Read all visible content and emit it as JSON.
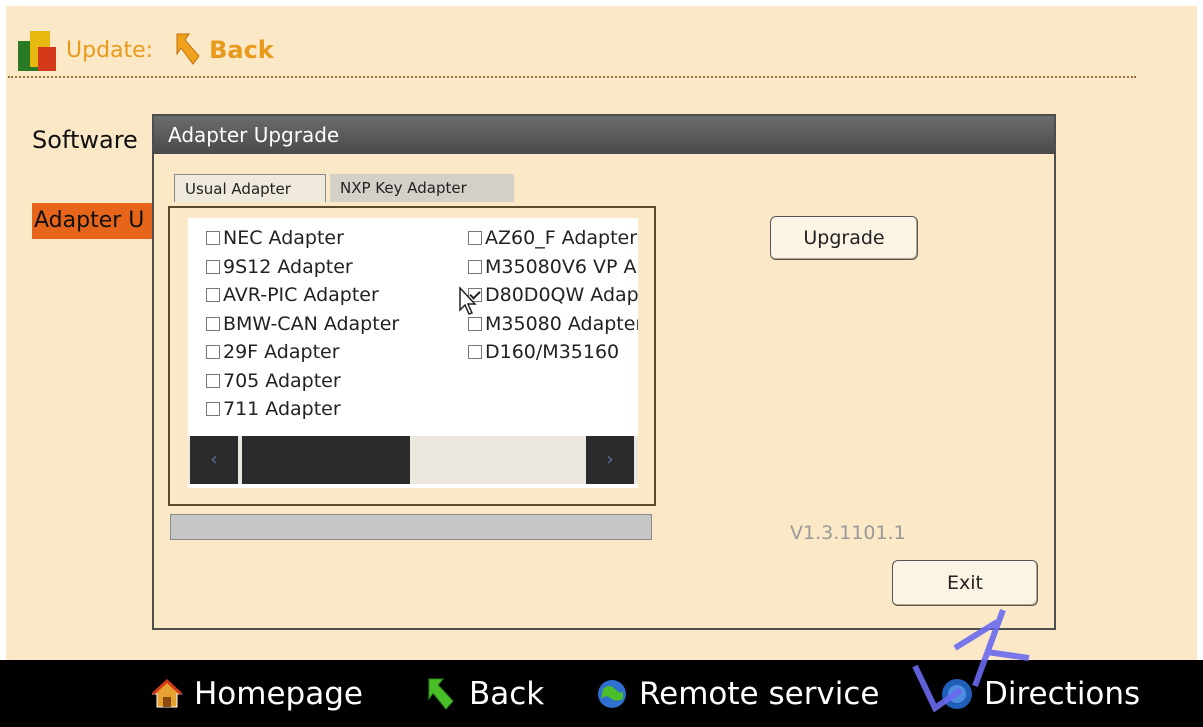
{
  "header": {
    "title": "Update:",
    "back_label": "Back"
  },
  "background": {
    "software_label": "Software",
    "adapter_label": "Adapter U"
  },
  "dialog": {
    "title": "Adapter Upgrade",
    "tabs": [
      {
        "label": "Usual Adapter",
        "active": true
      },
      {
        "label": "NXP Key Adapter",
        "active": false
      }
    ],
    "adapters_col1": [
      {
        "label": "NEC Adapter",
        "checked": false
      },
      {
        "label": "9S12 Adapter",
        "checked": false
      },
      {
        "label": "AVR-PIC Adapter",
        "checked": false
      },
      {
        "label": "BMW-CAN Adapter",
        "checked": false
      },
      {
        "label": "29F Adapter",
        "checked": false
      },
      {
        "label": "705 Adapter",
        "checked": false
      },
      {
        "label": "711 Adapter",
        "checked": false
      }
    ],
    "adapters_col2": [
      {
        "label": "AZ60_F Adapter",
        "checked": false
      },
      {
        "label": "M35080V6 VP A",
        "checked": false
      },
      {
        "label": "D80D0QW Adap",
        "checked": true
      },
      {
        "label": "M35080 Adapter",
        "checked": false
      },
      {
        "label": "D160/M35160",
        "checked": false
      }
    ],
    "upgrade_label": "Upgrade",
    "version": "V1.3.1101.1",
    "exit_label": "Exit",
    "progress": 0
  },
  "taskbar": {
    "homepage": "Homepage",
    "back": "Back",
    "remote": "Remote service",
    "directions": "Directions"
  },
  "colors": {
    "background": "#fbe8c6",
    "accent": "#e89a1c",
    "adapter_highlight": "#e6651b",
    "taskbar": "#000000"
  }
}
